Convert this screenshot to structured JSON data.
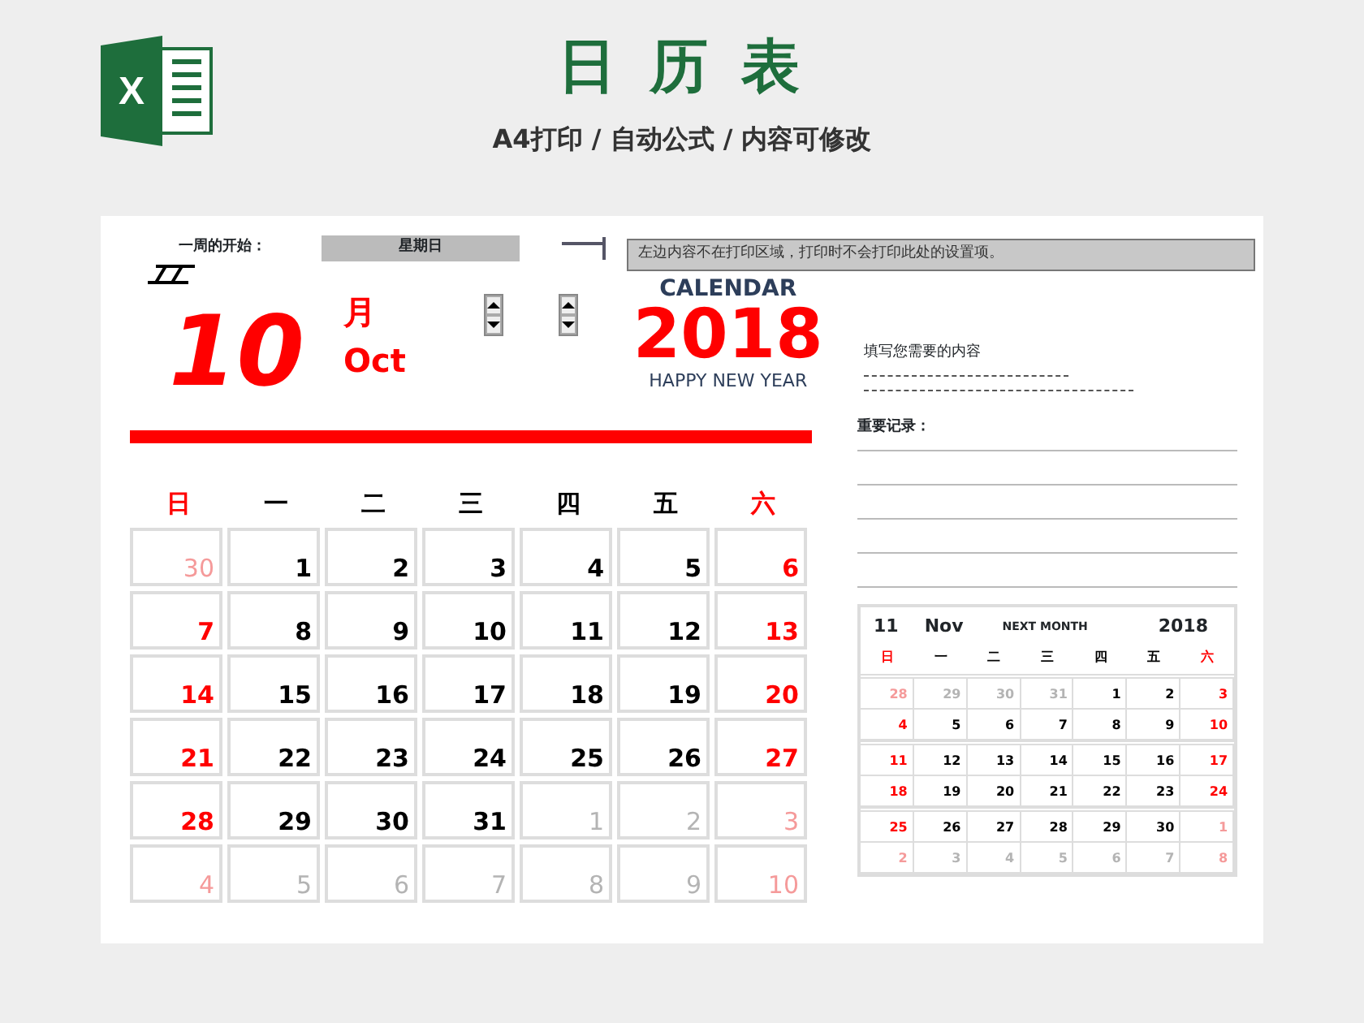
{
  "banner": {
    "logo_letter": "X",
    "title": "日 历 表",
    "subtitle": "A4打印 / 自动公式 / 内容可修改"
  },
  "settings": {
    "week_start_label": "一周的开始：",
    "week_start_value": "星期日",
    "note": "左边内容不在打印区域，打印时不会打印此处的设置项。"
  },
  "header": {
    "day": "10",
    "month_cn": "月",
    "month_en": "Oct",
    "calendar_label": "CALENDAR",
    "year": "2018",
    "greeting": "HAPPY NEW YEAR"
  },
  "weekdays": [
    {
      "label": "日",
      "weekend": true
    },
    {
      "label": "一",
      "weekend": false
    },
    {
      "label": "二",
      "weekend": false
    },
    {
      "label": "三",
      "weekend": false
    },
    {
      "label": "四",
      "weekend": false
    },
    {
      "label": "五",
      "weekend": false
    },
    {
      "label": "六",
      "weekend": true
    }
  ],
  "month_grid": [
    [
      {
        "text": "30",
        "kind": "other-weekend"
      },
      {
        "text": "1",
        "kind": "normal"
      },
      {
        "text": "2",
        "kind": "normal"
      },
      {
        "text": "3",
        "kind": "normal"
      },
      {
        "text": "4",
        "kind": "normal"
      },
      {
        "text": "5",
        "kind": "normal"
      },
      {
        "text": "6",
        "kind": "weekend"
      }
    ],
    [
      {
        "text": "7",
        "kind": "weekend"
      },
      {
        "text": "8",
        "kind": "normal"
      },
      {
        "text": "9",
        "kind": "normal"
      },
      {
        "text": "10",
        "kind": "normal"
      },
      {
        "text": "11",
        "kind": "normal"
      },
      {
        "text": "12",
        "kind": "normal"
      },
      {
        "text": "13",
        "kind": "weekend"
      }
    ],
    [
      {
        "text": "14",
        "kind": "weekend"
      },
      {
        "text": "15",
        "kind": "normal"
      },
      {
        "text": "16",
        "kind": "normal"
      },
      {
        "text": "17",
        "kind": "normal"
      },
      {
        "text": "18",
        "kind": "normal"
      },
      {
        "text": "19",
        "kind": "normal"
      },
      {
        "text": "20",
        "kind": "weekend"
      }
    ],
    [
      {
        "text": "21",
        "kind": "weekend"
      },
      {
        "text": "22",
        "kind": "normal"
      },
      {
        "text": "23",
        "kind": "normal"
      },
      {
        "text": "24",
        "kind": "normal"
      },
      {
        "text": "25",
        "kind": "normal"
      },
      {
        "text": "26",
        "kind": "normal"
      },
      {
        "text": "27",
        "kind": "weekend"
      }
    ],
    [
      {
        "text": "28",
        "kind": "weekend"
      },
      {
        "text": "29",
        "kind": "normal"
      },
      {
        "text": "30",
        "kind": "normal"
      },
      {
        "text": "31",
        "kind": "normal"
      },
      {
        "text": "1",
        "kind": "other"
      },
      {
        "text": "2",
        "kind": "other"
      },
      {
        "text": "3",
        "kind": "other-weekend"
      }
    ],
    [
      {
        "text": "4",
        "kind": "other-weekend"
      },
      {
        "text": "5",
        "kind": "other"
      },
      {
        "text": "6",
        "kind": "other"
      },
      {
        "text": "7",
        "kind": "other"
      },
      {
        "text": "8",
        "kind": "other"
      },
      {
        "text": "9",
        "kind": "other"
      },
      {
        "text": "10",
        "kind": "other-weekend"
      }
    ]
  ],
  "notes": {
    "prompt": "填写您需要的内容",
    "records_label": "重要记录："
  },
  "next_month": {
    "month_num": "11",
    "month_en": "Nov",
    "label": "NEXT MONTH",
    "year": "2018",
    "weekdays": [
      {
        "label": "日",
        "weekend": true
      },
      {
        "label": "一",
        "weekend": false
      },
      {
        "label": "二",
        "weekend": false
      },
      {
        "label": "三",
        "weekend": false
      },
      {
        "label": "四",
        "weekend": false
      },
      {
        "label": "五",
        "weekend": false
      },
      {
        "label": "六",
        "weekend": true
      }
    ],
    "grid": [
      [
        {
          "text": "28",
          "kind": "other-weekend"
        },
        {
          "text": "29",
          "kind": "other"
        },
        {
          "text": "30",
          "kind": "other"
        },
        {
          "text": "31",
          "kind": "other"
        },
        {
          "text": "1",
          "kind": "normal"
        },
        {
          "text": "2",
          "kind": "normal"
        },
        {
          "text": "3",
          "kind": "weekend"
        }
      ],
      [
        {
          "text": "4",
          "kind": "weekend"
        },
        {
          "text": "5",
          "kind": "normal"
        },
        {
          "text": "6",
          "kind": "normal"
        },
        {
          "text": "7",
          "kind": "normal"
        },
        {
          "text": "8",
          "kind": "normal"
        },
        {
          "text": "9",
          "kind": "normal"
        },
        {
          "text": "10",
          "kind": "weekend"
        }
      ],
      [
        {
          "text": "11",
          "kind": "weekend"
        },
        {
          "text": "12",
          "kind": "normal"
        },
        {
          "text": "13",
          "kind": "normal"
        },
        {
          "text": "14",
          "kind": "normal"
        },
        {
          "text": "15",
          "kind": "normal"
        },
        {
          "text": "16",
          "kind": "normal"
        },
        {
          "text": "17",
          "kind": "weekend"
        }
      ],
      [
        {
          "text": "18",
          "kind": "weekend"
        },
        {
          "text": "19",
          "kind": "normal"
        },
        {
          "text": "20",
          "kind": "normal"
        },
        {
          "text": "21",
          "kind": "normal"
        },
        {
          "text": "22",
          "kind": "normal"
        },
        {
          "text": "23",
          "kind": "normal"
        },
        {
          "text": "24",
          "kind": "weekend"
        }
      ],
      [
        {
          "text": "25",
          "kind": "weekend"
        },
        {
          "text": "26",
          "kind": "normal"
        },
        {
          "text": "27",
          "kind": "normal"
        },
        {
          "text": "28",
          "kind": "normal"
        },
        {
          "text": "29",
          "kind": "normal"
        },
        {
          "text": "30",
          "kind": "normal"
        },
        {
          "text": "1",
          "kind": "other-weekend"
        }
      ],
      [
        {
          "text": "2",
          "kind": "other-weekend"
        },
        {
          "text": "3",
          "kind": "other"
        },
        {
          "text": "4",
          "kind": "other"
        },
        {
          "text": "5",
          "kind": "other"
        },
        {
          "text": "6",
          "kind": "other"
        },
        {
          "text": "7",
          "kind": "other"
        },
        {
          "text": "8",
          "kind": "other-weekend"
        }
      ]
    ]
  }
}
